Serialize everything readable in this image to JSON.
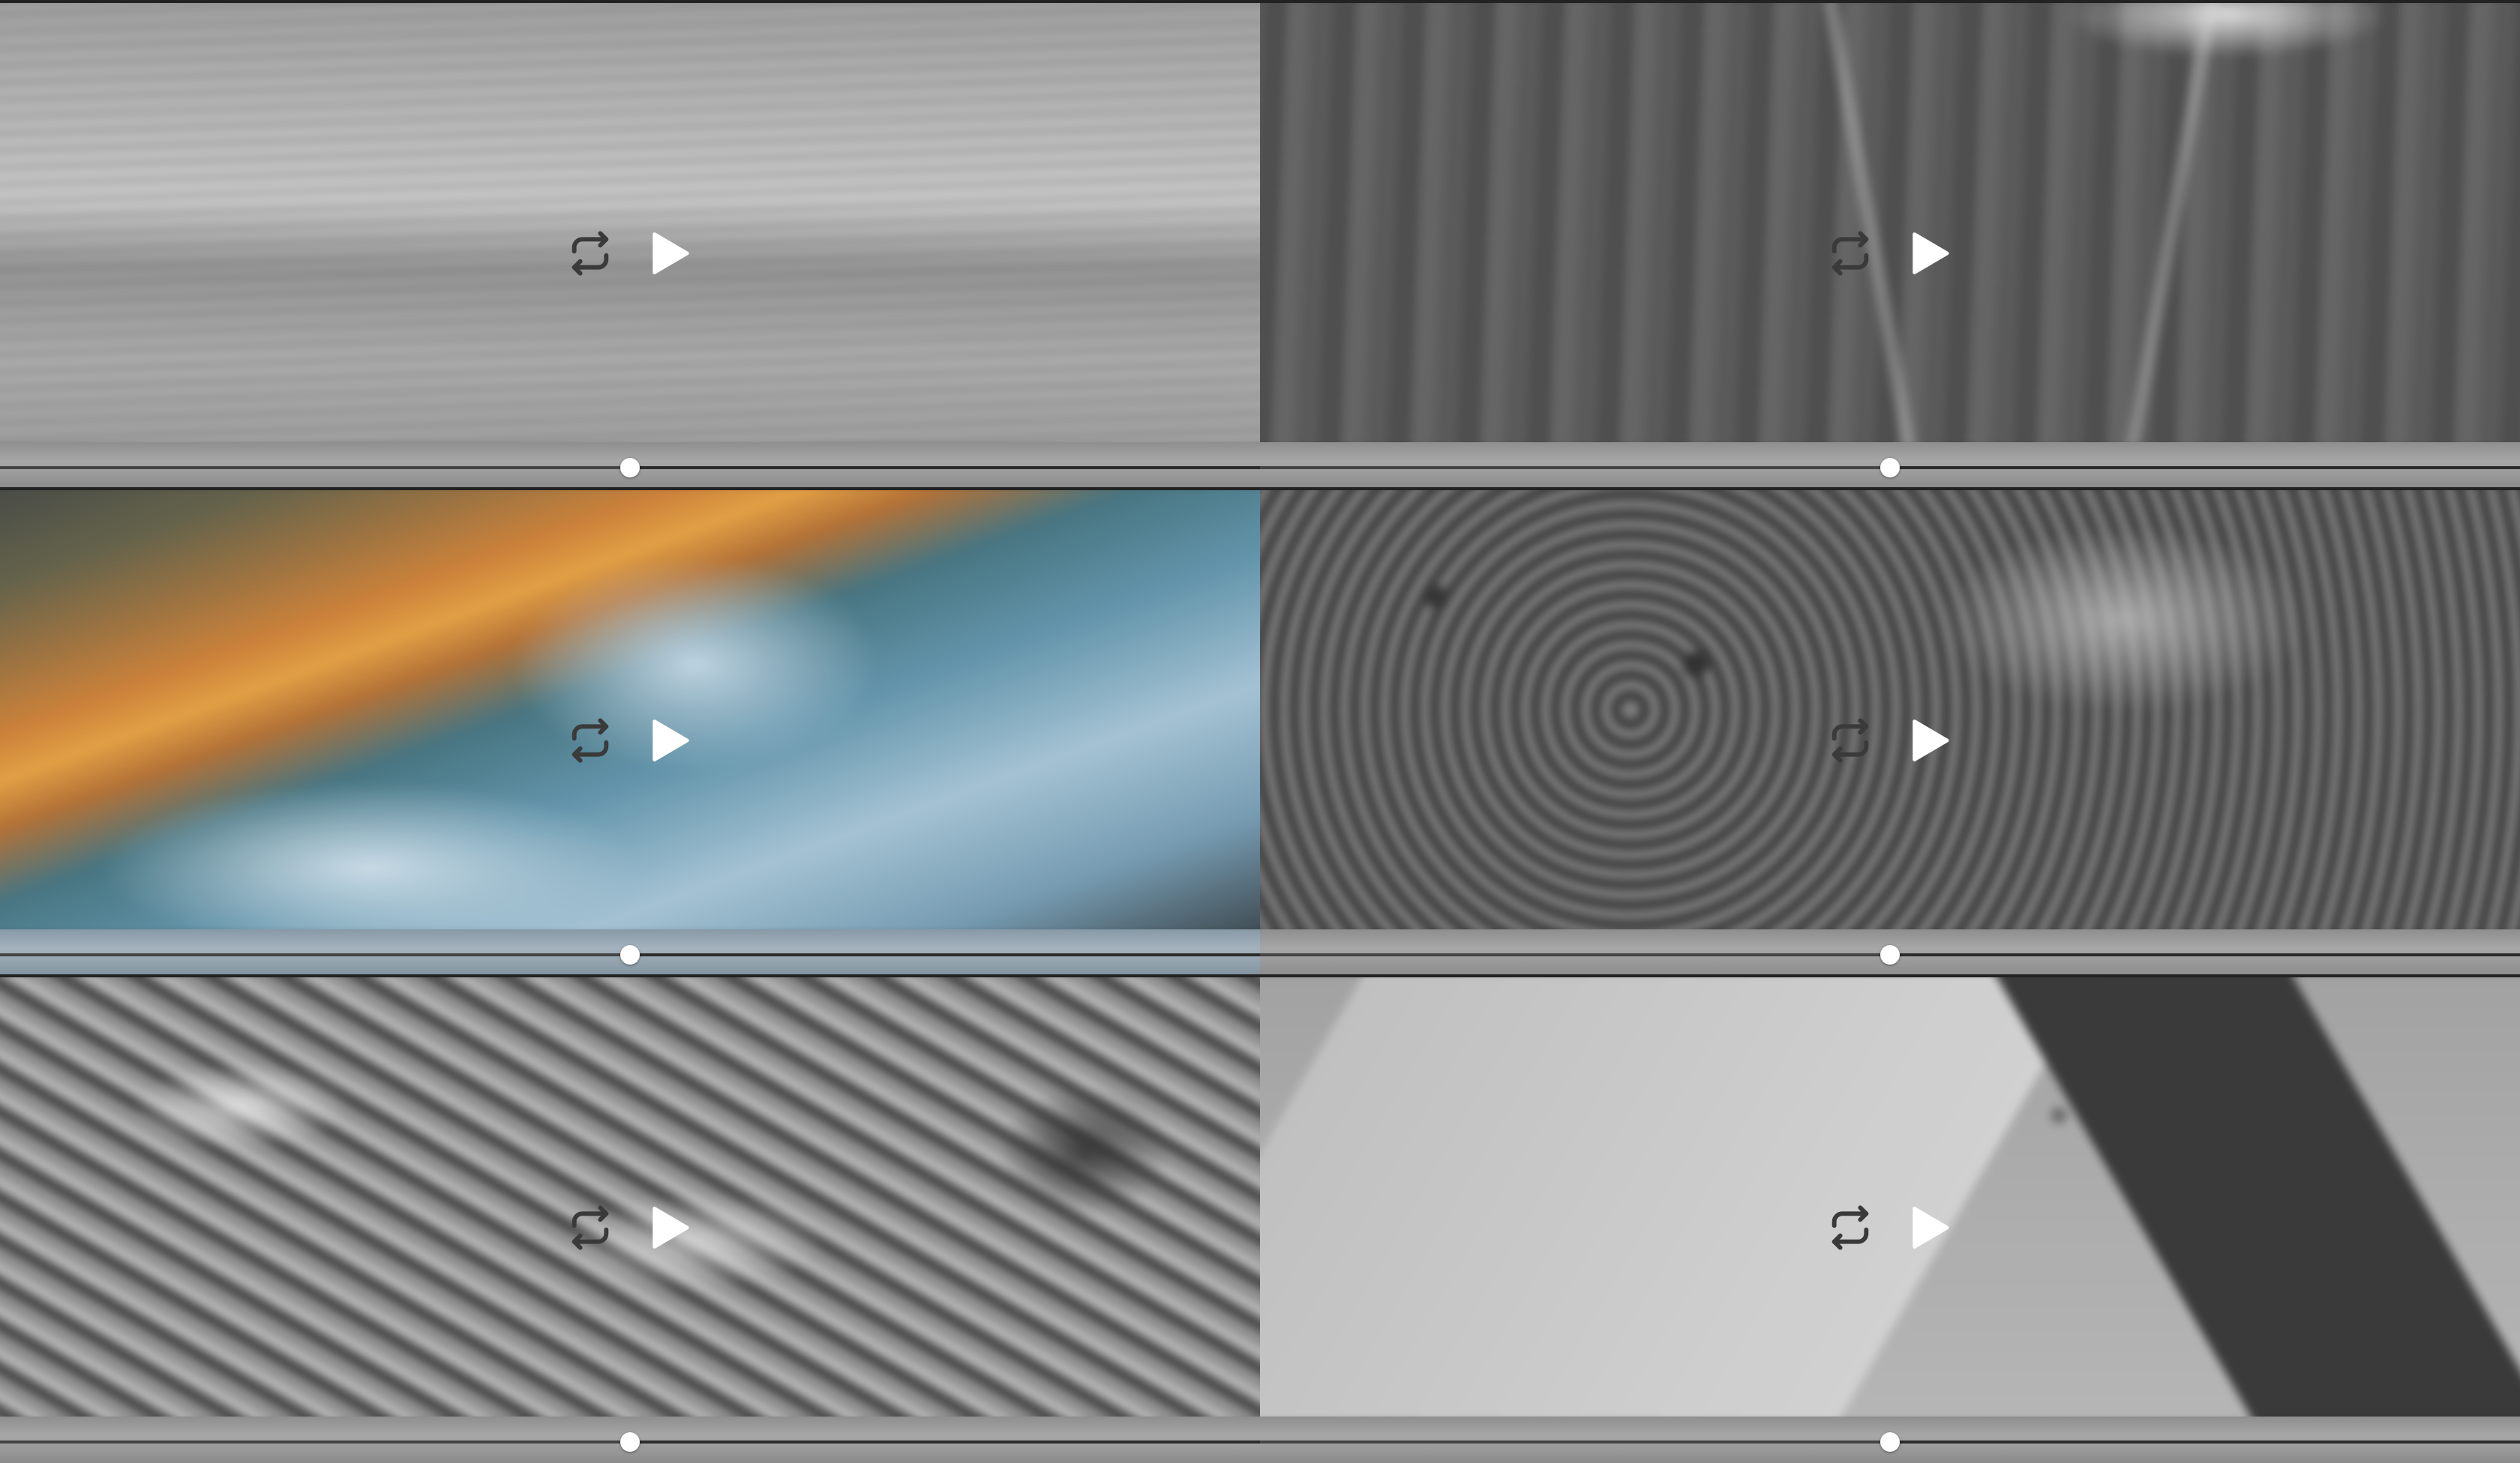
{
  "players": [
    {
      "id": "sea",
      "scene": "scene-sea",
      "colored": false,
      "progress": 0.5
    },
    {
      "id": "forest-railway",
      "scene": "scene-forest",
      "colored": false,
      "progress": 0.5
    },
    {
      "id": "wave",
      "scene": "scene-wave",
      "colored": true,
      "progress": 0.5
    },
    {
      "id": "cave-lantern",
      "scene": "scene-cave",
      "colored": false,
      "progress": 0.5
    },
    {
      "id": "engine",
      "scene": "scene-engine",
      "colored": false,
      "progress": 0.5
    },
    {
      "id": "desk-calculator",
      "scene": "scene-desk",
      "colored": false,
      "progress": 0.5
    }
  ],
  "icons": {
    "loop": "loop-icon",
    "play": "play-icon"
  },
  "colors": {
    "icon_loop": "#3a3a3a",
    "icon_play": "#ffffff",
    "thumb": "#ffffff",
    "track": "#2b2b2b"
  }
}
